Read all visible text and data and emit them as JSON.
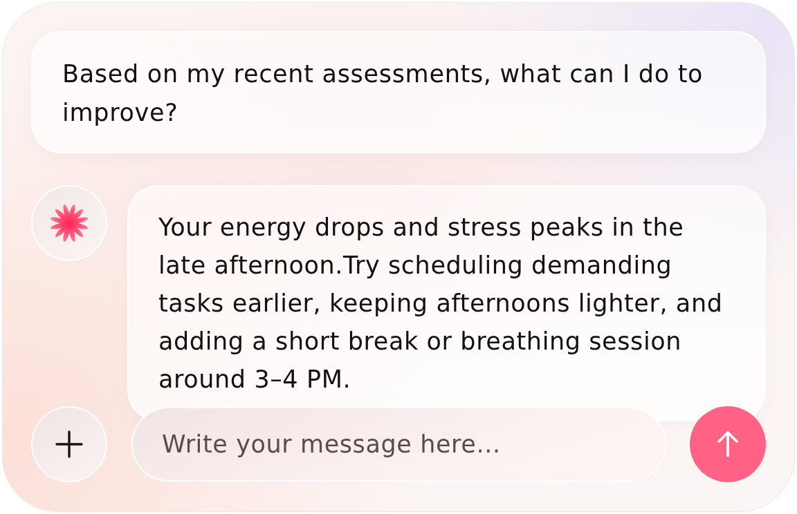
{
  "messages": [
    {
      "kind": "user",
      "text": "Based on my recent assessments, what can I do to improve?"
    },
    {
      "kind": "assistant",
      "text": "Your energy drops and stress peaks in the late afternoon.Try scheduling demanding tasks earlier, keeping afternoons lighter, and adding a short break or breathing session around 3–4 PM."
    }
  ],
  "composer": {
    "placeholder": "Write your message here..."
  }
}
